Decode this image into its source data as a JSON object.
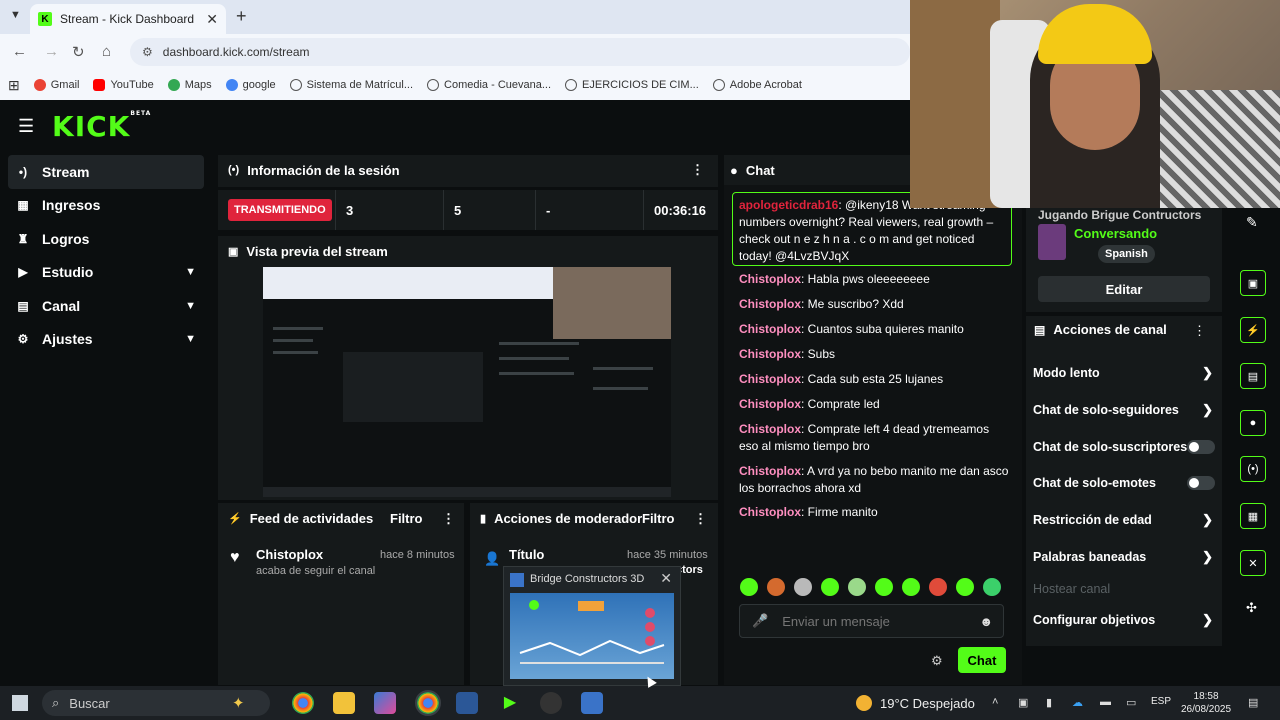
{
  "browser": {
    "tab_title": "Stream - Kick Dashboard",
    "url": "dashboard.kick.com/stream",
    "bookmarks": [
      {
        "label": "Gmail",
        "color": "#ea4335"
      },
      {
        "label": "YouTube",
        "color": "#ff0000"
      },
      {
        "label": "Maps",
        "color": "#34a853"
      },
      {
        "label": "google",
        "color": "#4285f4"
      },
      {
        "label": "Sistema de Matrícul...",
        "color": "#555555"
      },
      {
        "label": "Comedia - Cuevana...",
        "color": "#555555"
      },
      {
        "label": "EJERCICIOS DE CIM...",
        "color": "#555555"
      },
      {
        "label": "Adobe Acrobat",
        "color": "#555555"
      }
    ]
  },
  "brand": {
    "logo": "KICK",
    "badge": "BETA",
    "accent": "#53fc18"
  },
  "sidebar": {
    "items": [
      {
        "label": "Stream",
        "icon": "broadcast-icon"
      },
      {
        "label": "Ingresos",
        "icon": "wallet-icon"
      },
      {
        "label": "Logros",
        "icon": "trophy-icon"
      },
      {
        "label": "Estudio",
        "icon": "studio-icon"
      },
      {
        "label": "Canal",
        "icon": "channel-icon"
      },
      {
        "label": "Ajustes",
        "icon": "gear-icon"
      }
    ]
  },
  "session": {
    "title": "Información de la sesión",
    "status": "TRANSMITIENDO",
    "stat1": "3",
    "stat2": "5",
    "stat3": "-",
    "duration": "00:36:16"
  },
  "preview": {
    "title": "Vista previa del stream"
  },
  "activity": {
    "title": "Feed de actividades",
    "filter": "Filtro",
    "item": {
      "user": "Chistoplox",
      "text": "acaba de seguir el canal",
      "time": "hace 8 minutos"
    }
  },
  "moderator": {
    "title": "Acciones de moderador",
    "filter": "Filtro",
    "item": {
      "label": "Título",
      "time": "hace 35 minutos",
      "tail": "ctors"
    }
  },
  "popup": {
    "title": "Bridge Constructors 3D"
  },
  "chat": {
    "title": "Chat",
    "highlight": {
      "user": "apologeticdrab16",
      "text": ": @ikeny18 Want streaming numbers overnight? Real viewers, real growth – check out n e z h n a . c o m and get noticed today! @4LvzBVJqX"
    },
    "messages": [
      {
        "user": "Chistoplox",
        "text": "Habla pws oleeeeeeee"
      },
      {
        "user": "Chistoplox",
        "text": "Me suscribo? Xdd"
      },
      {
        "user": "Chistoplox",
        "text": "Cuantos suba quieres manito"
      },
      {
        "user": "Chistoplox",
        "text": "Subs"
      },
      {
        "user": "Chistoplox",
        "text": "Cada sub esta 25 lujanes"
      },
      {
        "user": "Chistoplox",
        "text": "Comprate led"
      },
      {
        "user": "Chistoplox",
        "text": "Comprate left 4 dead ytremeamos eso al mismo tiempo bro"
      },
      {
        "user": "Chistoplox",
        "text": "A vrd ya no bebo manito me dan asco los borrachos ahora xd"
      },
      {
        "user": "Chistoplox",
        "text": "Firme manito"
      }
    ],
    "placeholder": "Enviar un mensaje",
    "send": "Chat"
  },
  "stream_info": {
    "title": "Jugando Brigue Contructors",
    "category": "Conversando",
    "language": "Spanish",
    "edit": "Editar"
  },
  "channel_actions": {
    "title": "Acciones de canal",
    "items": [
      {
        "label": "Modo lento",
        "kind": "arrow"
      },
      {
        "label": "Chat de solo-seguidores",
        "kind": "arrow"
      },
      {
        "label": "Chat de solo-suscriptores",
        "kind": "toggle"
      },
      {
        "label": "Chat de solo-emotes",
        "kind": "toggle"
      },
      {
        "label": "Restricción de edad",
        "kind": "arrow"
      },
      {
        "label": "Palabras baneadas",
        "kind": "arrow"
      },
      {
        "label": "Hostear canal",
        "kind": "disabled"
      },
      {
        "label": "Configurar objetivos",
        "kind": "arrow"
      }
    ]
  },
  "taskbar": {
    "search": "Buscar",
    "weather": "19°C  Despejado",
    "lang": "ESP",
    "time": "18:58",
    "date": "26/08/2025"
  }
}
